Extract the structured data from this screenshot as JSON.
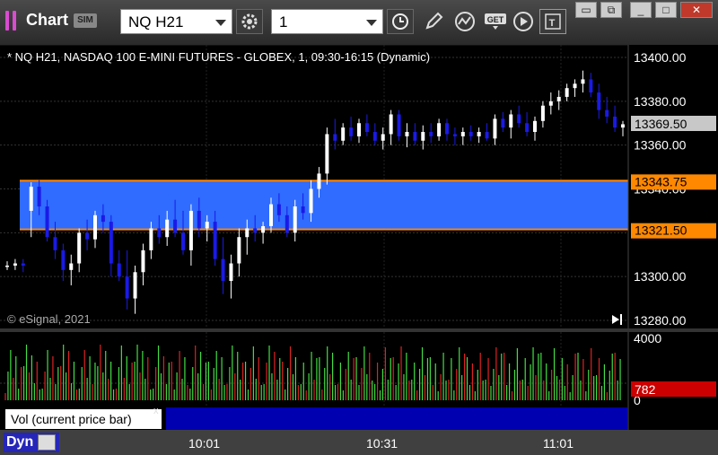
{
  "window": {
    "title": "Chart",
    "sim_badge": "SIM",
    "symbol": "NQ H21",
    "interval": "1"
  },
  "toolbar": {
    "icons": [
      "settings-icon",
      "clock-icon",
      "pencil-icon",
      "study-icon",
      "get-icon",
      "play-icon",
      "template-icon"
    ]
  },
  "chart": {
    "description": "* NQ H21, NASDAQ 100 E-MINI FUTURES - GLOBEX, 1, 09:30-16:15 (Dynamic)",
    "copyright": "© eSignal, 2021",
    "y_ticks": [
      "13400.00",
      "13380.00",
      "13360.00",
      "13340.00",
      "13300.00",
      "13280.00"
    ],
    "current_price": "13369.50",
    "zone_upper": "13343.75",
    "zone_lower": "13321.50",
    "x_ticks": [
      "10:01",
      "10:31",
      "11:01"
    ],
    "colors": {
      "up": "#ffffff",
      "down": "#1a1ae6",
      "zone": "#2f6cff",
      "zone_edge": "#ff8800",
      "price_tag": "#c8c8c8"
    }
  },
  "volume": {
    "label": "Vol (current price bar)",
    "close": "x",
    "y_ticks": [
      "4000",
      "0"
    ],
    "current": "782",
    "colors": {
      "up": "#44dd44",
      "down": "#dd2222"
    }
  },
  "bottom": {
    "mode": "Dyn"
  },
  "chart_data": {
    "type": "candlestick",
    "ylim": [
      13275,
      13405
    ],
    "candles": [
      [
        13305,
        13307,
        13303,
        13305
      ],
      [
        13305,
        13308,
        13303,
        13306
      ],
      [
        13306,
        13308,
        13302,
        13305
      ],
      [
        13330,
        13343,
        13318,
        13341
      ],
      [
        13341,
        13344,
        13328,
        13332
      ],
      [
        13332,
        13335,
        13316,
        13318
      ],
      [
        13318,
        13325,
        13308,
        13312
      ],
      [
        13312,
        13315,
        13298,
        13303
      ],
      [
        13303,
        13310,
        13296,
        13306
      ],
      [
        13306,
        13322,
        13302,
        13320
      ],
      [
        13320,
        13326,
        13312,
        13317
      ],
      [
        13317,
        13330,
        13313,
        13328
      ],
      [
        13328,
        13333,
        13320,
        13325
      ],
      [
        13325,
        13328,
        13300,
        13306
      ],
      [
        13306,
        13312,
        13298,
        13300
      ],
      [
        13300,
        13312,
        13285,
        13290
      ],
      [
        13290,
        13305,
        13283,
        13302
      ],
      [
        13302,
        13315,
        13296,
        13312
      ],
      [
        13312,
        13325,
        13308,
        13322
      ],
      [
        13322,
        13328,
        13315,
        13318
      ],
      [
        13318,
        13330,
        13314,
        13326
      ],
      [
        13326,
        13335,
        13318,
        13320
      ],
      [
        13320,
        13330,
        13310,
        13312
      ],
      [
        13312,
        13333,
        13305,
        13330
      ],
      [
        13330,
        13336,
        13318,
        13322
      ],
      [
        13322,
        13328,
        13316,
        13325
      ],
      [
        13325,
        13330,
        13305,
        13308
      ],
      [
        13308,
        13318,
        13292,
        13298
      ],
      [
        13298,
        13310,
        13290,
        13306
      ],
      [
        13306,
        13322,
        13300,
        13318
      ],
      [
        13318,
        13326,
        13310,
        13322
      ],
      [
        13322,
        13328,
        13316,
        13320
      ],
      [
        13320,
        13325,
        13315,
        13323
      ],
      [
        13323,
        13336,
        13320,
        13333
      ],
      [
        13333,
        13338,
        13325,
        13328
      ],
      [
        13328,
        13332,
        13318,
        13320
      ],
      [
        13320,
        13335,
        13316,
        13332
      ],
      [
        13332,
        13338,
        13326,
        13329
      ],
      [
        13329,
        13344,
        13325,
        13340
      ],
      [
        13340,
        13350,
        13336,
        13347
      ],
      [
        13347,
        13368,
        13342,
        13365
      ],
      [
        13365,
        13372,
        13358,
        13362
      ],
      [
        13362,
        13370,
        13360,
        13368
      ],
      [
        13368,
        13373,
        13362,
        13364
      ],
      [
        13364,
        13372,
        13361,
        13370
      ],
      [
        13370,
        13374,
        13364,
        13366
      ],
      [
        13366,
        13370,
        13360,
        13362
      ],
      [
        13362,
        13368,
        13358,
        13365
      ],
      [
        13365,
        13376,
        13360,
        13374
      ],
      [
        13374,
        13376,
        13362,
        13364
      ],
      [
        13364,
        13370,
        13359,
        13366
      ],
      [
        13366,
        13370,
        13360,
        13362
      ],
      [
        13362,
        13369,
        13358,
        13366
      ],
      [
        13366,
        13370,
        13361,
        13364
      ],
      [
        13364,
        13372,
        13362,
        13370
      ],
      [
        13370,
        13372,
        13362,
        13365
      ],
      [
        13365,
        13368,
        13360,
        13364
      ],
      [
        13364,
        13368,
        13360,
        13366
      ],
      [
        13366,
        13369,
        13362,
        13364
      ],
      [
        13364,
        13368,
        13361,
        13366
      ],
      [
        13366,
        13370,
        13362,
        13363
      ],
      [
        13363,
        13374,
        13360,
        13372
      ],
      [
        13372,
        13375,
        13366,
        13368
      ],
      [
        13368,
        13376,
        13363,
        13374
      ],
      [
        13374,
        13378,
        13368,
        13370
      ],
      [
        13370,
        13375,
        13364,
        13366
      ],
      [
        13366,
        13373,
        13362,
        13371
      ],
      [
        13371,
        13380,
        13368,
        13378
      ],
      [
        13378,
        13384,
        13374,
        13380
      ],
      [
        13380,
        13385,
        13376,
        13382
      ],
      [
        13382,
        13388,
        13380,
        13386
      ],
      [
        13386,
        13390,
        13382,
        13388
      ],
      [
        13388,
        13394,
        13384,
        13390
      ],
      [
        13390,
        13393,
        13382,
        13384
      ],
      [
        13384,
        13388,
        13372,
        13376
      ],
      [
        13376,
        13382,
        13370,
        13373
      ],
      [
        13373,
        13378,
        13366,
        13368
      ],
      [
        13368,
        13371,
        13364,
        13369.5
      ]
    ]
  }
}
